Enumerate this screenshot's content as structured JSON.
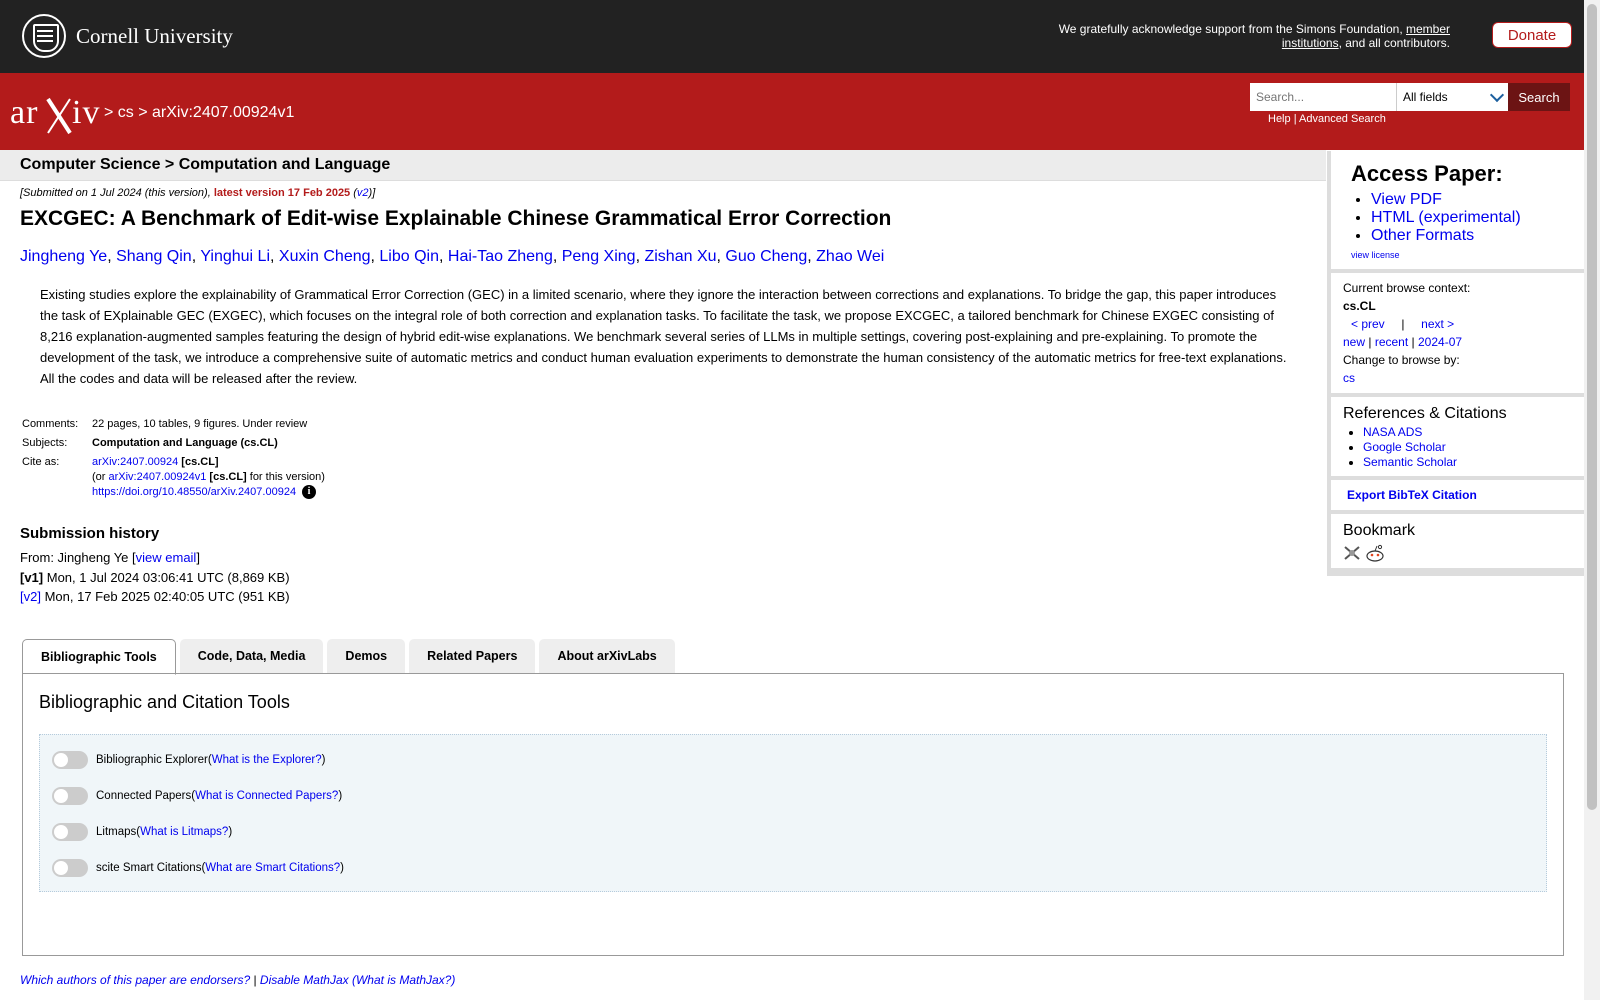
{
  "header": {
    "org_name": "Cornell University",
    "ack_text_1": "We gratefully acknowledge support from the Simons Foundation, ",
    "ack_link": "member institutions",
    "ack_text_2": ", and all contributors.",
    "donate": "Donate"
  },
  "nav": {
    "logo": "arXiv",
    "crumb": "> cs > arXiv:2407.00924v1",
    "search_placeholder": "Search...",
    "search_field": "All fields",
    "search_button": "Search",
    "help": "Help",
    "sep": "|",
    "advanced": "Advanced Search"
  },
  "subheader": "Computer Science > Computation and Language",
  "paper": {
    "submitted_prefix": "[Submitted on 1 Jul 2024 (this version), ",
    "latest": "latest version 17 Feb 2025",
    "v2_open": " (",
    "v2": "v2",
    "v2_close": ")]",
    "title": "EXCGEC: A Benchmark of Edit-wise Explainable Chinese Grammatical Error Correction",
    "authors": [
      "Jingheng Ye",
      "Shang Qin",
      "Yinghui Li",
      "Xuxin Cheng",
      "Libo Qin",
      "Hai-Tao Zheng",
      "Peng Xing",
      "Zishan Xu",
      "Guo Cheng",
      "Zhao Wei"
    ],
    "abstract": "Existing studies explore the explainability of Grammatical Error Correction (GEC) in a limited scenario, where they ignore the interaction between corrections and explanations. To bridge the gap, this paper introduces the task of EXplainable GEC (EXGEC), which focuses on the integral role of both correction and explanation tasks. To facilitate the task, we propose EXCGEC, a tailored benchmark for Chinese EXGEC consisting of 8,216 explanation-augmented samples featuring the design of hybrid edit-wise explanations. We benchmark several series of LLMs in multiple settings, covering post-explaining and pre-explaining. To promote the development of the task, we introduce a comprehensive suite of automatic metrics and conduct human evaluation experiments to demonstrate the human consistency of the automatic metrics for free-text explanations. All the codes and data will be released after the review."
  },
  "meta": {
    "comments_label": "Comments:",
    "comments": "22 pages, 10 tables, 9 figures. Under review",
    "subjects_label": "Subjects:",
    "subjects": "Computation and Language (cs.CL)",
    "cite_label": "Cite as:",
    "cite_link": "arXiv:2407.00924",
    "cite_tag": " [cs.CL]",
    "or_prefix": "(or ",
    "cite_v1": "arXiv:2407.00924v1",
    "cite_v1_tag": " [cs.CL]",
    "cite_v1_suffix": " for this version)",
    "doi": "https://doi.org/10.48550/arXiv.2407.00924",
    "info_icon": "i"
  },
  "history": {
    "title": "Submission history",
    "from_prefix": "From: Jingheng Ye [",
    "view_email": "view email",
    "from_suffix": "]",
    "v1_label": "[v1]",
    "v1_text": " Mon, 1 Jul 2024 03:06:41 UTC (8,869 KB)",
    "v2_label": "[v2]",
    "v2_text": " Mon, 17 Feb 2025 02:40:05 UTC (951 KB)"
  },
  "sidebar": {
    "access_title": "Access Paper:",
    "access_links": [
      "View PDF",
      "HTML (experimental)",
      "Other Formats"
    ],
    "view_license": "view license",
    "context_label": "Current browse context:",
    "context_value": "cs.CL",
    "prev": "< prev",
    "nav_sep": "|",
    "next": "next >",
    "new": "new",
    "recent": "recent",
    "month": "2024-07",
    "bar": "|",
    "change_label": "Change to browse by:",
    "change_value": "cs",
    "refs_title": "References & Citations",
    "refs_links": [
      "NASA ADS",
      "Google Scholar",
      "Semantic Scholar"
    ],
    "export": "Export BibTeX Citation",
    "bookmark_title": "Bookmark"
  },
  "tabs": [
    "Bibliographic Tools",
    "Code, Data, Media",
    "Demos",
    "Related Papers",
    "About arXivLabs"
  ],
  "tools": {
    "title": "Bibliographic and Citation Tools",
    "rows": [
      {
        "name": "Bibliographic Explorer",
        "link": "What is the Explorer?"
      },
      {
        "name": "Connected Papers",
        "link": "What is Connected Papers?"
      },
      {
        "name": "Litmaps",
        "link": "What is Litmaps?"
      },
      {
        "name": "scite Smart Citations",
        "link": "What are Smart Citations?"
      }
    ],
    "open_paren": " (",
    "close_paren": ")"
  },
  "footer": {
    "endorsers": "Which authors of this paper are endorsers?",
    "sep": " | ",
    "disable": "Disable MathJax",
    "open": " (",
    "what": "What is MathJax?",
    "close": ")"
  }
}
